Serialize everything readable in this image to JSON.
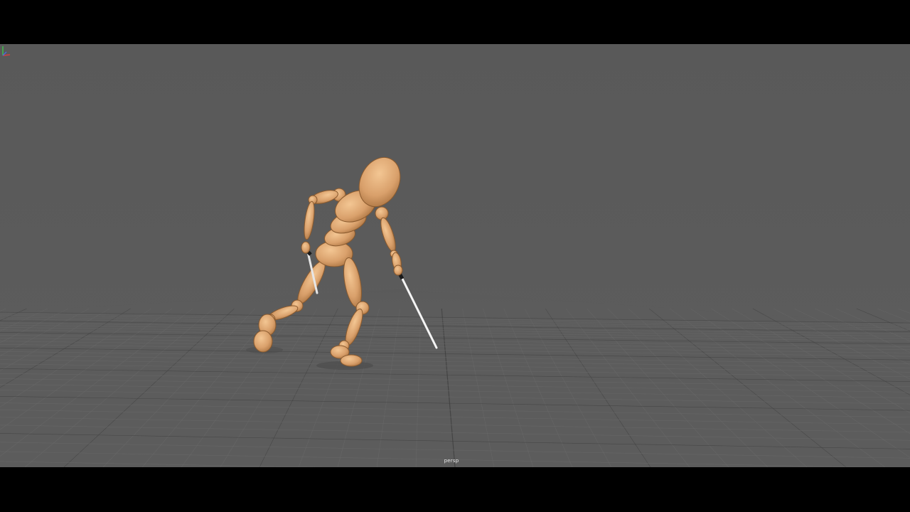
{
  "viewport": {
    "camera_name": "persp",
    "background_color": "#5a5a5a",
    "grid_color": "#6a6a6a",
    "grid_major_color": "#3f3f3f"
  },
  "scene": {
    "character": "wooden-mannequin-figure",
    "props": [
      "sword-left-hand",
      "sword-right-hand"
    ],
    "skin_color": "#d9a06b",
    "blade_color": "#f2f2f2"
  },
  "axis_gizmo": {
    "icons": [
      "axis-y-icon",
      "axis-x-icon",
      "axis-z-icon"
    ],
    "colors": {
      "x": "#d24040",
      "y": "#3fbf4a",
      "z": "#4a6adf"
    }
  }
}
